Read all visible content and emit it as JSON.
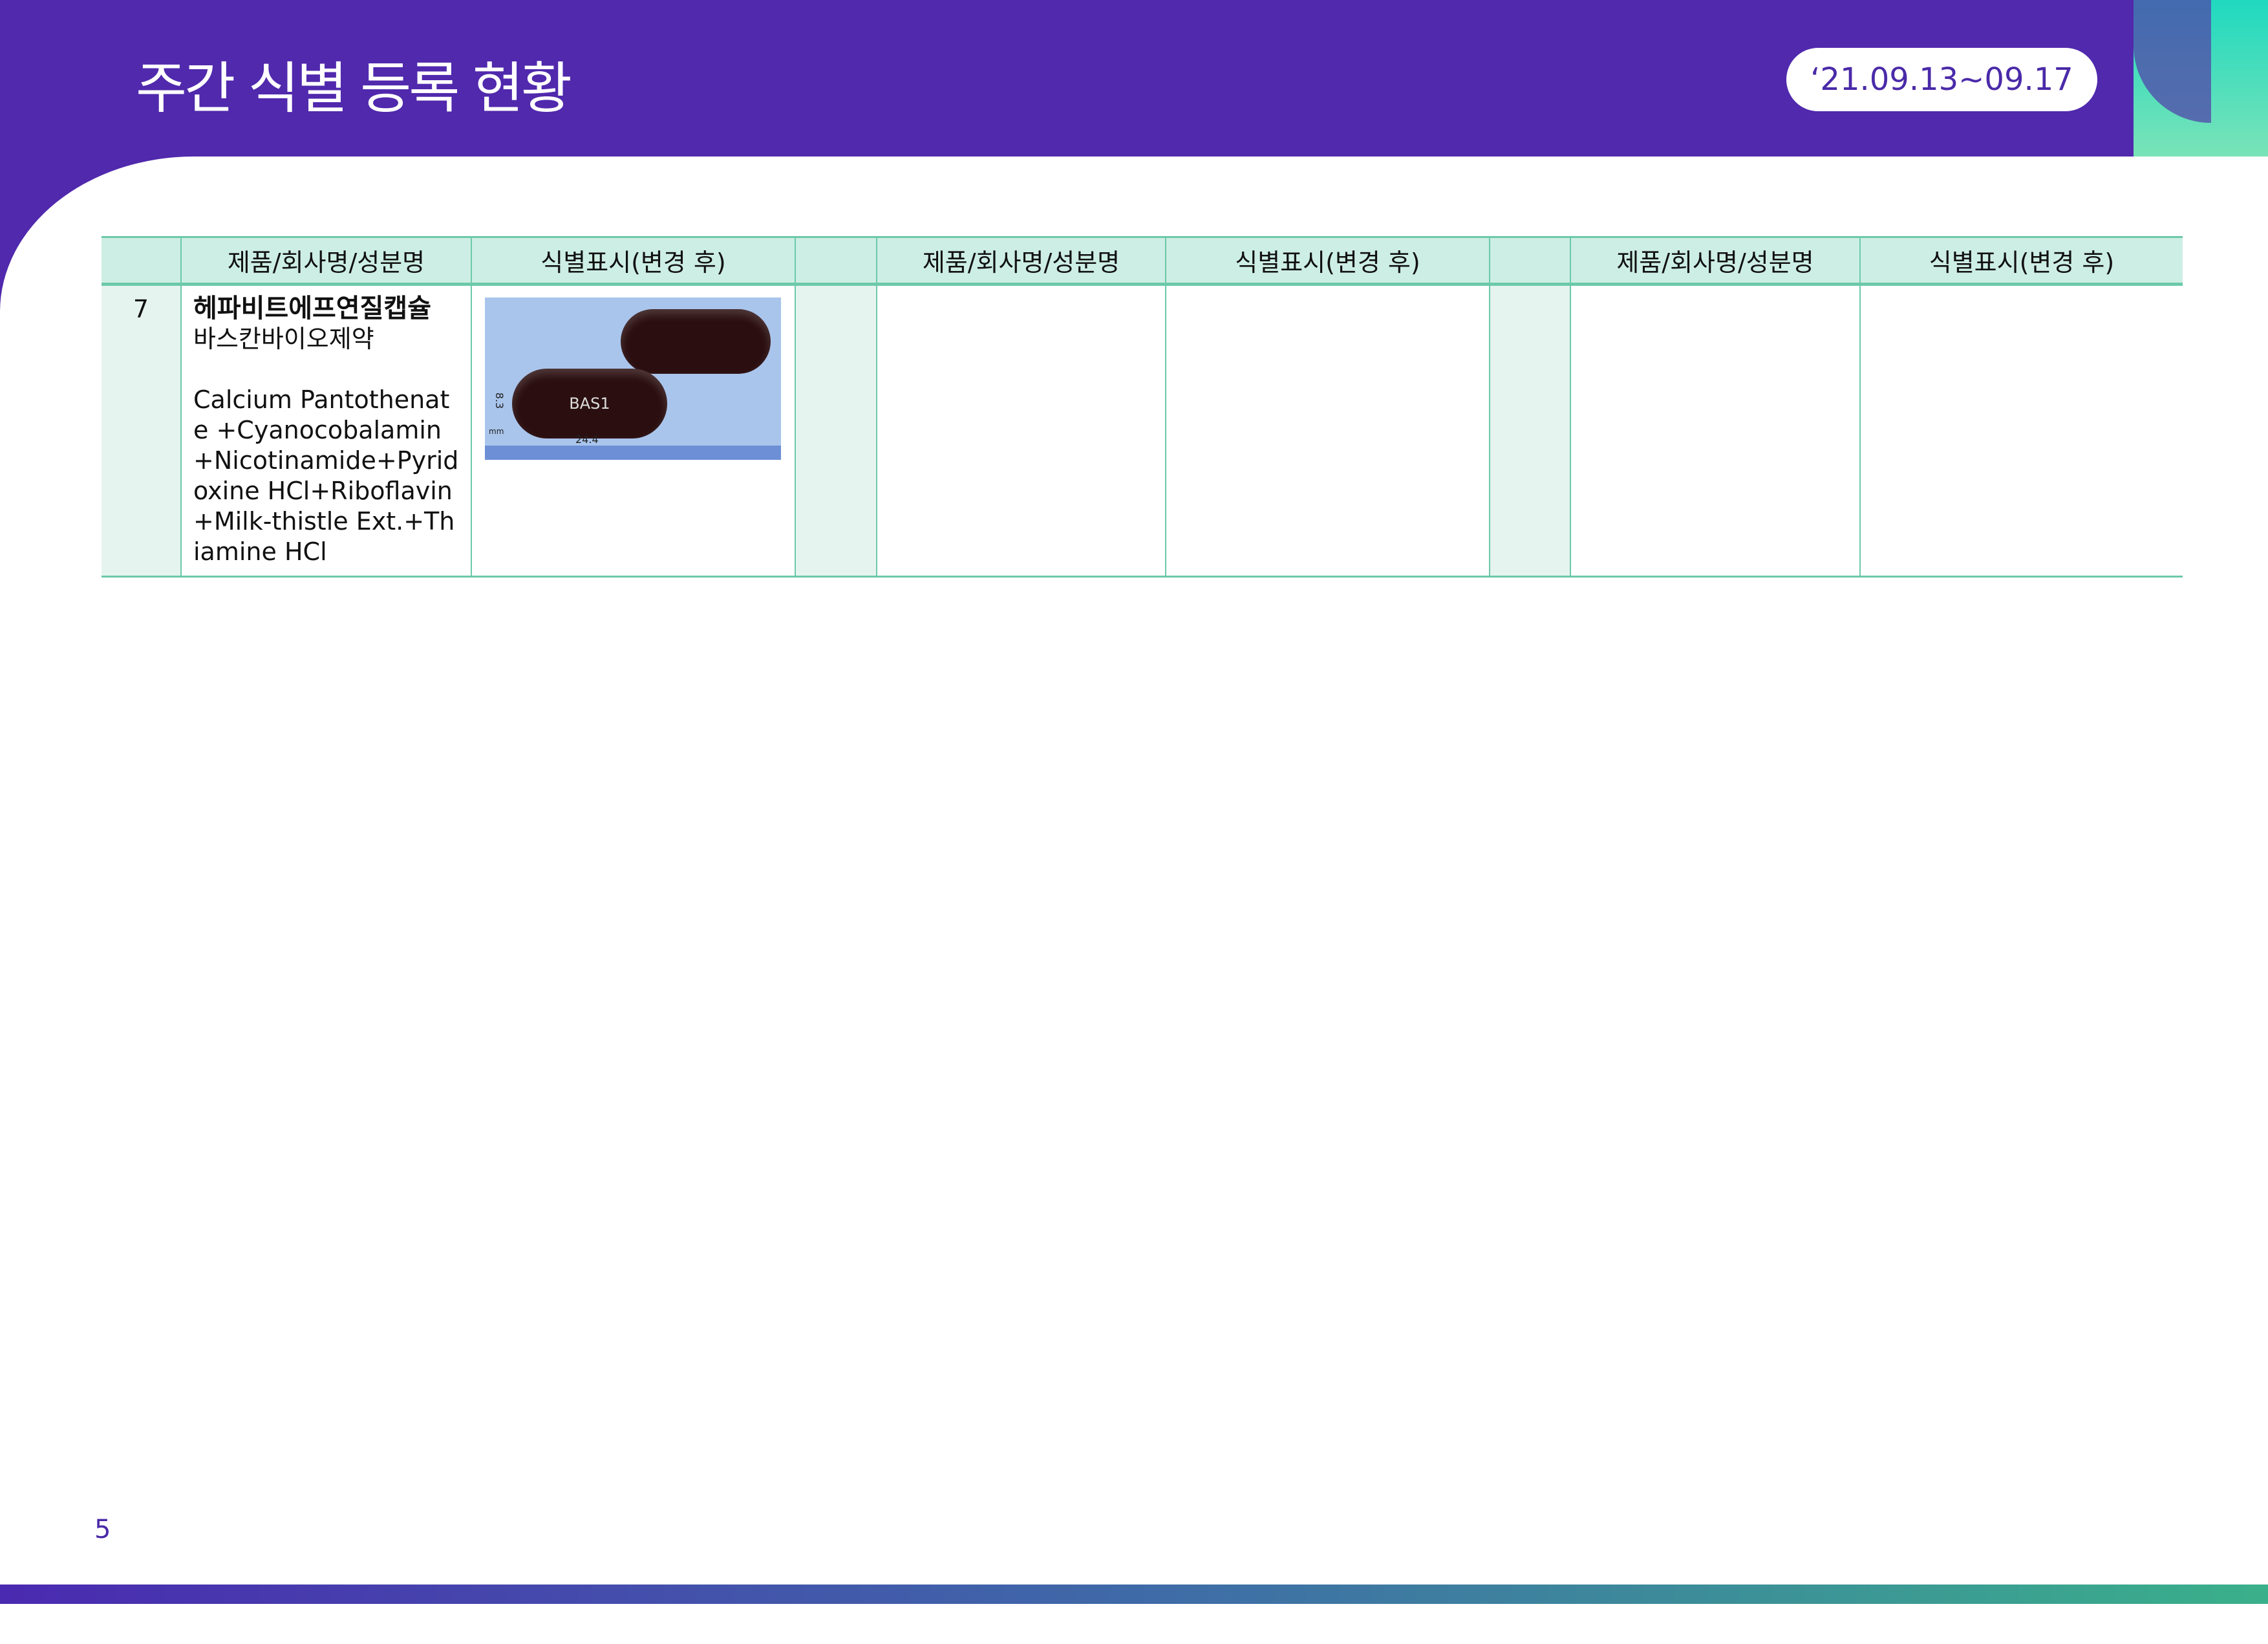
{
  "header": {
    "title": "주간 식별 등록 현황",
    "date_range": "‘21.09.13~09.17"
  },
  "table": {
    "headers": [
      "",
      "제품/회사명/성분명",
      "식별표시(변경 후)",
      "",
      "제품/회사명/성분명",
      "식별표시(변경 후)",
      "",
      "제품/회사명/성분명",
      "식별표시(변경 후)"
    ],
    "rows": [
      {
        "no": "7",
        "product": "헤파비트에프연질캡슐",
        "company": "바스칸바이오제약",
        "ingredients": "Calcium Pantothenate +Cyanocobalamin+Nicotinamide+Pyridoxine HCl+Riboflavin+Milk-thistle Ext.+Thiamine HCl",
        "image": {
          "imprint": "BAS1",
          "height_mm": "8.3",
          "width_mm": "24.4",
          "unit": "mm"
        }
      }
    ]
  },
  "footer": {
    "page": "5"
  }
}
